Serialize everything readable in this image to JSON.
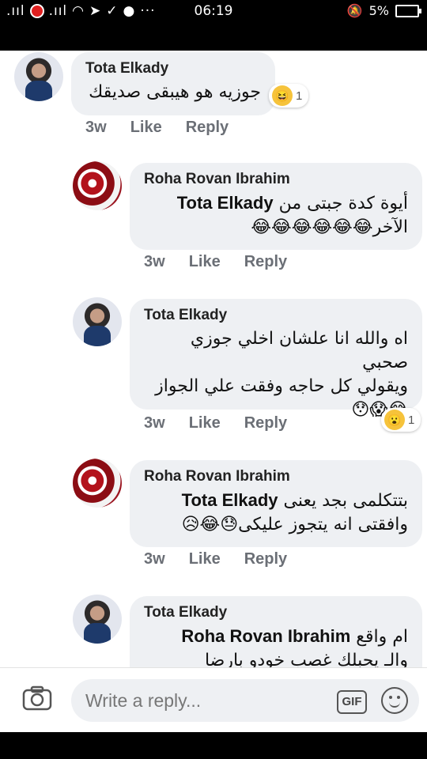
{
  "status_bar": {
    "signal_left": ".ııl",
    "signal_right": ".ııl",
    "time": "06:19",
    "battery": "5%",
    "icons": [
      "signal-icon",
      "record-icon",
      "wifi-icon",
      "telegram-icon",
      "nfc-icon",
      "messenger-icon",
      "more-dots-icon",
      "mute-icon",
      "battery-icon"
    ]
  },
  "comments": [
    {
      "author": "Tota Elkady",
      "text": "جوزيه هو هيبقى صديقك",
      "mention": "",
      "emojis": "",
      "reaction_count": "1",
      "time": "3w",
      "like": "Like",
      "reply": "Reply"
    },
    {
      "author": "Roha Rovan Ibrahim",
      "mention": "Tota Elkady",
      "text": "أيوة كدة جبتى من",
      "text2": "الآخر",
      "emojis": "😂😂😂😂😂😂",
      "time": "3w",
      "like": "Like",
      "reply": "Reply"
    },
    {
      "author": "Tota Elkady",
      "text": "اه والله انا علشان اخلي جوزي صحبي",
      "text2": "ويقولي كل حاجه وفقت علي الجواز",
      "emojis": "😂😱😯",
      "reaction_count": "1",
      "time": "3w",
      "like": "Like",
      "reply": "Reply"
    },
    {
      "author": "Roha Rovan Ibrahim",
      "mention": "Tota Elkady",
      "text": "بتتكلمى بجد يعنى",
      "text2": "وافقتى انه يتجوز عليكى",
      "emojis": "😓😂😥",
      "time": "3w",
      "like": "Like",
      "reply": "Reply"
    },
    {
      "author": "Tota Elkady",
      "mention": "Roha Rovan Ibrahim",
      "text": "ام واقع",
      "text2": "والـ يحبلك غصب خودو بارضا"
    }
  ],
  "reply_bar": {
    "placeholder": "Write a reply...",
    "gif_label": "GIF"
  },
  "colors": {
    "bubble": "#eef0f3",
    "meta_text": "#6b6f76",
    "emoji": "#f6c33b"
  }
}
